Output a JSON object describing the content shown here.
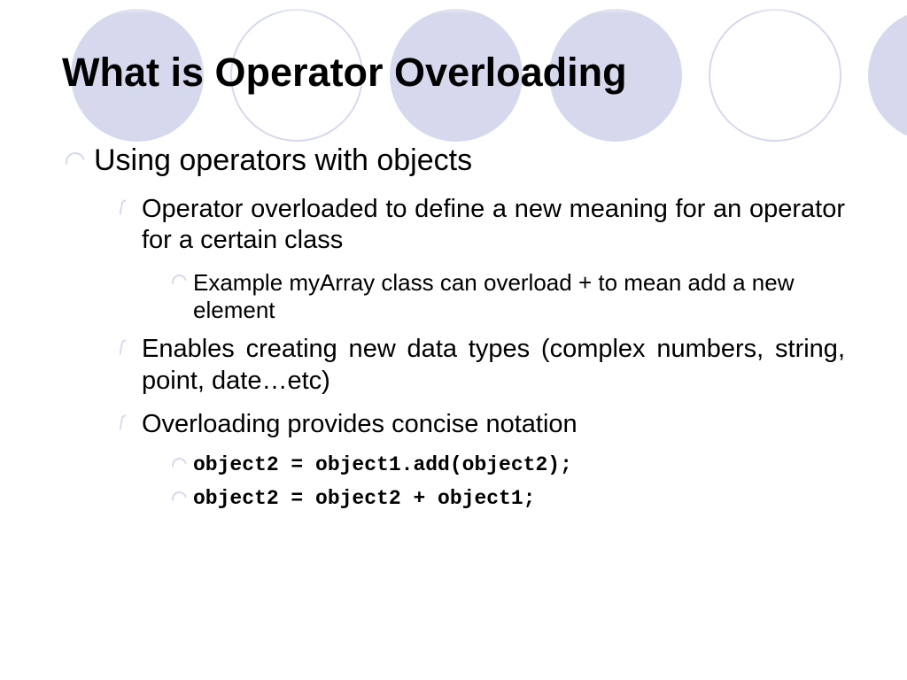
{
  "title": "What is Operator Overloading",
  "bullets": {
    "lvl1": "Using operators with objects",
    "sub": [
      {
        "text": "Operator overloaded to define a new meaning for an operator for a certain class",
        "children": [
          {
            "text": "Example myArray class can overload + to mean add a new element",
            "code": false
          }
        ]
      },
      {
        "text": "Enables creating new data types (complex numbers, string, point, date…etc)",
        "children": []
      },
      {
        "text": "Overloading provides concise notation",
        "children": [
          {
            "text": "object2 = object1.add(object2);",
            "code": true
          },
          {
            "text": "object2 = object2 + object1;",
            "code": true
          }
        ]
      }
    ]
  },
  "colors": {
    "accent": "#d6d9ed"
  }
}
